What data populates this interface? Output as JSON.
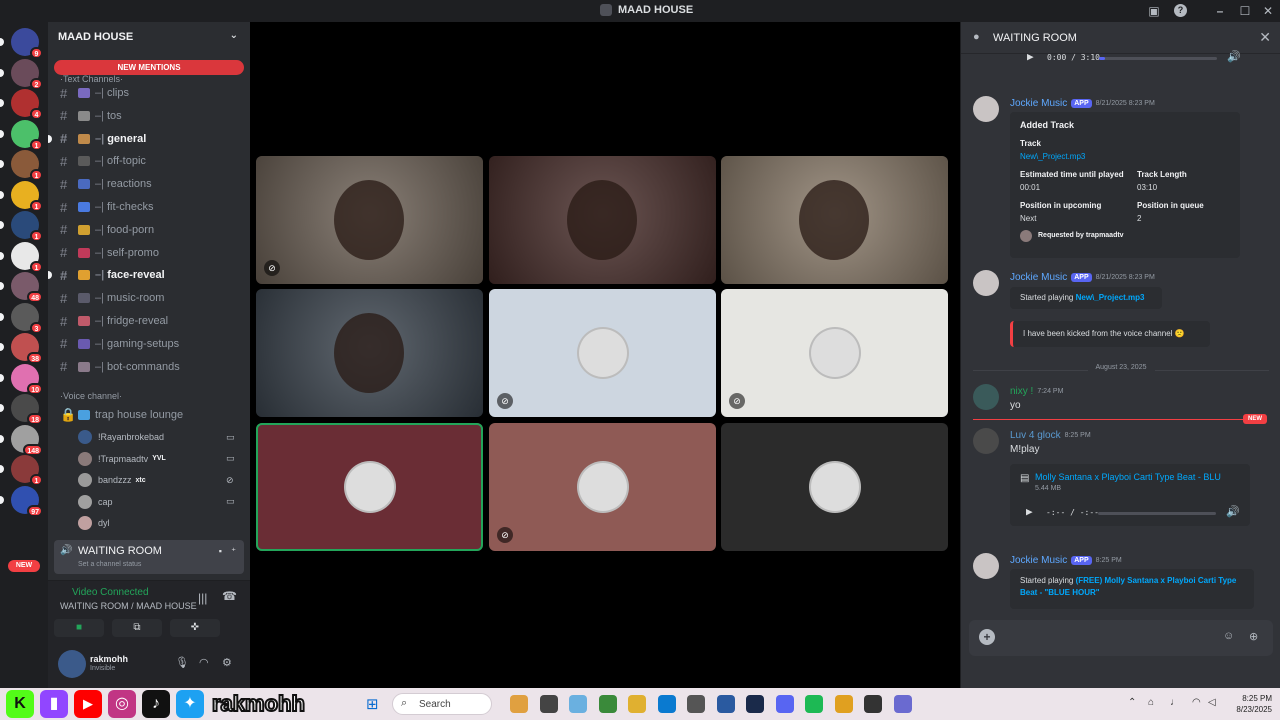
{
  "window": {
    "title": "MAAD HOUSE"
  },
  "rail": {
    "servers": [
      {
        "badge": "9",
        "color": "#3b4a9c"
      },
      {
        "badge": "2",
        "color": "#6a4b5a"
      },
      {
        "badge": "4",
        "color": "#b03030"
      },
      {
        "badge": "1",
        "color": "#4cc06a"
      },
      {
        "badge": "1",
        "color": "#8a5a3a"
      },
      {
        "badge": "1",
        "color": "#e8b020"
      },
      {
        "badge": "1",
        "color": "#2a4a7a"
      },
      {
        "badge": "1",
        "color": "#e8e8e8"
      },
      {
        "badge": "48",
        "color": "#7a5a6a"
      },
      {
        "badge": "3",
        "color": "#5a5a5a"
      },
      {
        "badge": "38",
        "color": "#c05050"
      },
      {
        "badge": "10",
        "color": "#e070b0"
      },
      {
        "badge": "18",
        "color": "#4a4a4a"
      },
      {
        "badge": "148",
        "color": "#a0a0a0"
      },
      {
        "badge": "1",
        "color": "#8a3a3a"
      },
      {
        "badge": "97",
        "color": "#3050b0"
      }
    ],
    "new_label": "NEW"
  },
  "sidebar": {
    "server_name": "MAAD HOUSE",
    "new_mentions": "NEW MENTIONS",
    "text_category": "·Text Channels·",
    "channels": [
      {
        "name": "clips",
        "color": "#7a6ac0",
        "unread": false
      },
      {
        "name": "tos",
        "color": "#8a8a8a",
        "unread": false
      },
      {
        "name": "general",
        "color": "#c08a4a",
        "unread": true
      },
      {
        "name": "off-topic",
        "color": "#5a5a5a",
        "unread": false
      },
      {
        "name": "reactions",
        "color": "#4a6ac0",
        "unread": false
      },
      {
        "name": "fit-checks",
        "color": "#4a7ae0",
        "unread": false
      },
      {
        "name": "food-porn",
        "color": "#d0a030",
        "unread": false
      },
      {
        "name": "self-promo",
        "color": "#c03a5a",
        "unread": false
      },
      {
        "name": "face-reveal",
        "color": "#e0a030",
        "unread": true
      },
      {
        "name": "music-room",
        "color": "#5a5a6a",
        "unread": false
      },
      {
        "name": "fridge-reveal",
        "color": "#c05a6a",
        "unread": false
      },
      {
        "name": "gaming-setups",
        "color": "#6a5ab0",
        "unread": false
      },
      {
        "name": "bot-commands",
        "color": "#8a7a8a",
        "unread": false
      }
    ],
    "voice_category": "·Voice channel·",
    "voice_channel": "trap house lounge",
    "voice_users": [
      {
        "name": "!Rayanbrokebad",
        "tag": "",
        "color": "#3a5a8a",
        "status": "▭"
      },
      {
        "name": "!Trapmaadtv",
        "tag": "YVL",
        "color": "#8a7a7a",
        "status": "▭"
      },
      {
        "name": "bandzzz",
        "tag": "xtc",
        "color": "#9a9a9a",
        "status": "⊘"
      },
      {
        "name": "cap",
        "tag": "",
        "color": "#a0a0a0",
        "status": "▭"
      },
      {
        "name": "dyl",
        "tag": "",
        "color": "#c0a0a0",
        "status": ""
      }
    ],
    "selected_channel": "WAITING ROOM",
    "selected_status": "Set a channel status",
    "voice_connected": "Video Connected",
    "voice_path": "WAITING ROOM / MAAD HOUSE",
    "user": {
      "name": "rakmohh",
      "status": "Invisible"
    }
  },
  "stage": {
    "tiles": [
      {
        "kind": "video",
        "bg": "#6f6358",
        "muted": true
      },
      {
        "kind": "video",
        "bg": "#4a2f2c",
        "muted": false
      },
      {
        "kind": "video",
        "bg": "#8c7d6c",
        "muted": false
      },
      {
        "kind": "video",
        "bg": "#3d4650",
        "muted": false
      },
      {
        "kind": "avatar",
        "bg": "#cdd6e0",
        "muted": true
      },
      {
        "kind": "avatar",
        "bg": "#e6e6e2",
        "muted": true
      },
      {
        "kind": "avatar",
        "bg": "#6a2d35",
        "muted": false,
        "active": true
      },
      {
        "kind": "avatar",
        "bg": "#8f5a55",
        "muted": true
      },
      {
        "kind": "avatar",
        "bg": "#2b2b2b",
        "muted": false
      }
    ]
  },
  "chat": {
    "title": "WAITING ROOM",
    "top_audio": {
      "time": "0:00 / 3:10",
      "progress": 0.05
    },
    "messages": [
      {
        "author": "Jockie Music",
        "app": "APP",
        "time": "8/21/2025 8:23 PM",
        "color": "#5ea8ff",
        "embed": {
          "title": "Added Track",
          "track_label": "Track",
          "track_value": "New\\_Project.mp3",
          "eta_label": "Estimated time until played",
          "eta_value": "00:01",
          "len_label": "Track Length",
          "len_value": "03:10",
          "pos_label": "Position in upcoming",
          "pos_value": "Next",
          "queue_label": "Position in queue",
          "queue_value": "2",
          "requested": "Requested by trapmaadtv"
        }
      },
      {
        "author": "Jockie Music",
        "app": "APP",
        "time": "8/21/2025 8:23 PM",
        "color": "#5ea8ff",
        "started_prefix": "Started playing ",
        "started_track": "New\\_Project.mp3",
        "kicked": "I have been kicked from the voice channel 🙁"
      }
    ],
    "date_divider": "August 23, 2025",
    "nixy": {
      "author": "nixy !",
      "time": "7:24 PM",
      "text": "yo",
      "color": "#23a55a"
    },
    "new_label": "NEW",
    "luv": {
      "author": "Luv 4 glock",
      "time": "8:25 PM",
      "text": "M!play",
      "color": "#5a9ad0",
      "file": "Molly Santana x Playboi Carti Type Beat - BLU",
      "size": "5.44 MB",
      "audio_time": "-:-- / -:--",
      "audio_progress": 0.0
    },
    "last": {
      "author": "Jockie Music",
      "app": "APP",
      "time": "8:25 PM",
      "prefix": "Started playing ",
      "track": "(FREE) Molly Santana x Playboi Carti Type Beat - \"BLUE HOUR\""
    }
  },
  "taskbar": {
    "handle": "rakmohh",
    "search_placeholder": "Search",
    "clock_time": "8:25 PM",
    "clock_date": "8/23/2025",
    "apps": [
      "#e0a040",
      "#444",
      "#6ab0e0",
      "#3a8a3a",
      "#e0b030",
      "#0a7ad0",
      "#555",
      "#2a5aa0",
      "#1a2a4a",
      "#5865f2",
      "#1db954",
      "#e0a020",
      "#333",
      "#6a6ad0"
    ]
  }
}
